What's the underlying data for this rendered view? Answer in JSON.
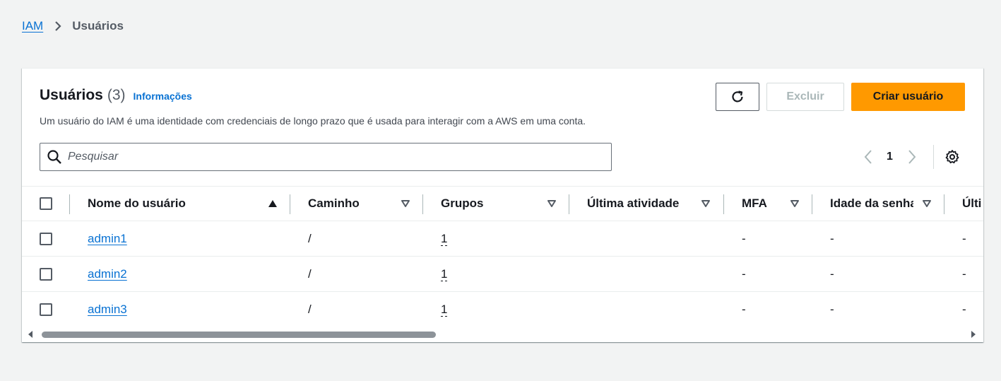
{
  "breadcrumb": {
    "root": "IAM",
    "current": "Usuários"
  },
  "panel": {
    "title": "Usuários",
    "count": "(3)",
    "info_link": "Informações",
    "description": "Um usuário do IAM é uma identidade com credenciais de longo prazo que é usada para interagir com a AWS em uma conta."
  },
  "actions": {
    "delete_label": "Excluir",
    "create_label": "Criar usuário"
  },
  "search": {
    "placeholder": "Pesquisar",
    "value": ""
  },
  "pagination": {
    "current_page": "1"
  },
  "table": {
    "columns": [
      {
        "label": "Nome do usuário",
        "sort": "ascending"
      },
      {
        "label": "Caminho",
        "sort": "none"
      },
      {
        "label": "Grupos",
        "sort": "none"
      },
      {
        "label": "Última atividade",
        "sort": "none"
      },
      {
        "label": "MFA",
        "sort": "none"
      },
      {
        "label": "Idade da senha",
        "sort": "none"
      },
      {
        "label": "Últi",
        "sort": "none"
      }
    ],
    "rows": [
      {
        "name": "admin1",
        "path": "/",
        "groups": "1",
        "last_activity": "",
        "mfa": "-",
        "password_age": "-",
        "last": "-"
      },
      {
        "name": "admin2",
        "path": "/",
        "groups": "1",
        "last_activity": "",
        "mfa": "-",
        "password_age": "-",
        "last": "-"
      },
      {
        "name": "admin3",
        "path": "/",
        "groups": "1",
        "last_activity": "",
        "mfa": "-",
        "password_age": "-",
        "last": "-"
      }
    ]
  },
  "colors": {
    "link": "#0972d3",
    "primary_button": "#ff9900",
    "background": "#f2f3f3",
    "disabled_text": "#aab7b8"
  },
  "icons": {
    "breadcrumb_separator": "chevron-right-icon",
    "refresh": "refresh-icon",
    "search": "search-icon",
    "prev_page": "chevron-left-icon",
    "next_page": "chevron-right-icon",
    "settings": "gear-icon",
    "sort_asc": "caret-up-icon",
    "sort_none": "caret-down-outline-icon"
  }
}
